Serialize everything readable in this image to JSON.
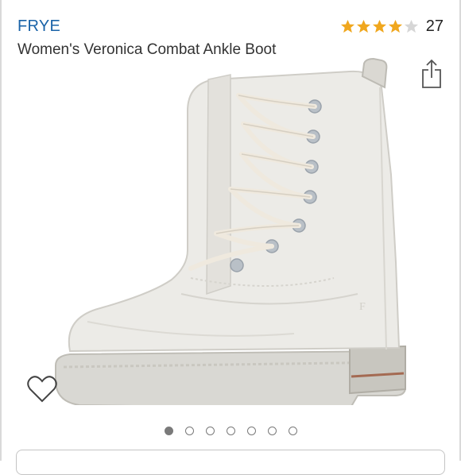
{
  "product": {
    "brand": "FRYE",
    "title": "Women's Veronica Combat Ankle Boot",
    "rating": 4,
    "max_rating": 5,
    "review_count": "27"
  },
  "gallery": {
    "image_count": 7,
    "active_index": 0
  },
  "icons": {
    "share": "share-icon",
    "favorite": "heart-icon"
  },
  "colors": {
    "brand_link": "#1a63a8",
    "star": "#f0a71e",
    "boot": "#ecebe7"
  }
}
